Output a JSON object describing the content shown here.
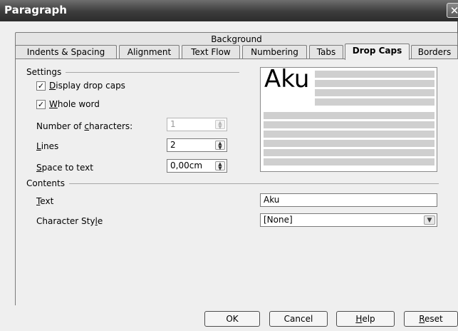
{
  "window": {
    "title": "Paragraph",
    "close_glyph": "✕"
  },
  "tabs_top": {
    "background": "Background"
  },
  "tabs": [
    {
      "label": "Indents & Spacing"
    },
    {
      "label": "Alignment"
    },
    {
      "label": "Text Flow"
    },
    {
      "label": "Numbering"
    },
    {
      "label": "Tabs"
    },
    {
      "label": "Drop Caps"
    },
    {
      "label": "Borders"
    }
  ],
  "settings": {
    "title": "Settings",
    "display_drop_caps": {
      "pre": "",
      "u": "D",
      "post": "isplay drop caps",
      "checked": true
    },
    "whole_word": {
      "pre": "",
      "u": "W",
      "post": "hole word",
      "checked": true
    },
    "number_of_characters": {
      "pre": "Number of ",
      "u": "c",
      "post": "haracters:",
      "value": "1"
    },
    "lines": {
      "pre": "",
      "u": "L",
      "post": "ines",
      "value": "2"
    },
    "space_to_text": {
      "pre": "",
      "u": "S",
      "post": "pace to text",
      "value": "0,00cm"
    }
  },
  "contents": {
    "title": "Contents",
    "text": {
      "pre": "",
      "u": "T",
      "post": "ext",
      "value": "Aku"
    },
    "character_style": {
      "pre": "Character Sty",
      "u": "l",
      "post": "e",
      "value": "[None]"
    }
  },
  "preview": {
    "drop_text": "Aku"
  },
  "buttons": {
    "ok": "OK",
    "cancel": "Cancel",
    "help": {
      "pre": "",
      "u": "H",
      "post": "elp"
    },
    "reset": {
      "pre": "",
      "u": "R",
      "post": "eset"
    }
  },
  "icons": {
    "check": "✓",
    "spin_up": "▲",
    "spin_down": "▼",
    "dropdown": "▼"
  }
}
